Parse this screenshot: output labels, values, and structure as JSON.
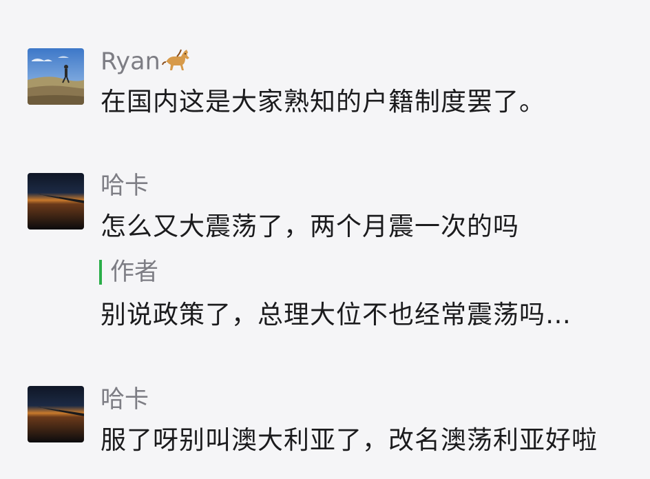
{
  "comments": [
    {
      "name": "Ryan",
      "name_emoji": "horse-emoji",
      "text": "在国内这是大家熟知的户籍制度罢了。",
      "avatar": "landscape-photo"
    },
    {
      "name": "哈卡",
      "text": "怎么又大震荡了，两个月震一次的吗",
      "avatar": "sunset-wing-photo",
      "reply": {
        "author": "作者",
        "text": "别说政策了，总理大位不也经常震荡吗…",
        "mark_color": "#2bae4a"
      }
    },
    {
      "name": "哈卡",
      "text": "服了呀别叫澳大利亚了，改名澳荡利亚好啦",
      "avatar": "sunset-wing-photo"
    }
  ],
  "colors": {
    "background": "#f5f5f7",
    "name": "#7d7d84",
    "text": "#1b1b1d",
    "reply_mark": "#2bae4a"
  }
}
